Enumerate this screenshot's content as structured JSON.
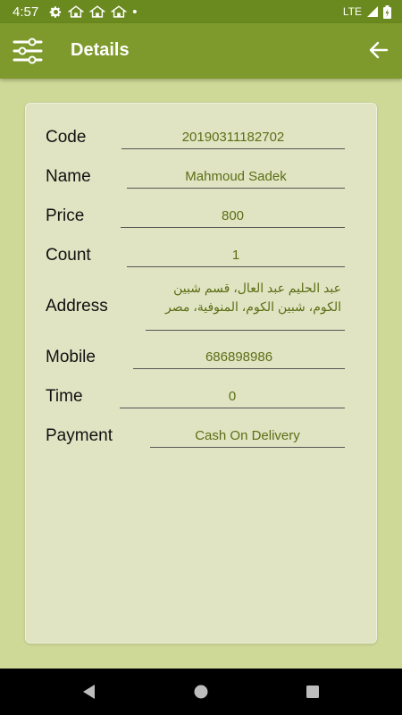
{
  "status": {
    "time": "4:57",
    "network": "LTE",
    "dot": "•"
  },
  "appbar": {
    "title": "Details",
    "menu_icon": "sliders-icon",
    "back_icon": "arrow-back-icon"
  },
  "details": {
    "code": {
      "label": "Code",
      "value": "20190311182702"
    },
    "name": {
      "label": "Name",
      "value": "Mahmoud Sadek"
    },
    "price": {
      "label": "Price",
      "value": "800"
    },
    "count": {
      "label": "Count",
      "value": "1"
    },
    "address": {
      "label": "Address",
      "value": "عبد الحليم عبد العال، قسم شبين الكوم، شبين الكوم، المنوفية، مصر"
    },
    "mobile": {
      "label": "Mobile",
      "value": "686898986"
    },
    "time": {
      "label": "Time",
      "value": "0"
    },
    "payment": {
      "label": "Payment",
      "value": "Cash On Delivery"
    }
  },
  "colors": {
    "primary": "#7f9a2c",
    "primary_dark": "#6a8a1f",
    "background": "#cfd997",
    "card": "#e0e4c2",
    "value_text": "#5c6e16"
  }
}
